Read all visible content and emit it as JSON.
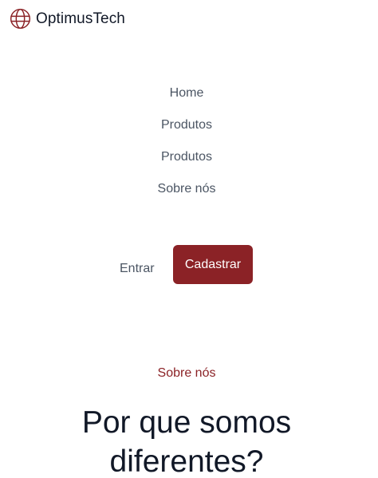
{
  "brand": {
    "name": "OptimusTech",
    "icon": "globe-icon",
    "color": "#8b2226"
  },
  "nav": {
    "items": [
      {
        "label": "Home"
      },
      {
        "label": "Produtos"
      },
      {
        "label": "Produtos"
      },
      {
        "label": "Sobre nós"
      }
    ]
  },
  "auth": {
    "login_label": "Entrar",
    "signup_label": "Cadastrar"
  },
  "section": {
    "eyebrow": "Sobre nós",
    "title_line1": "Por que somos",
    "title_line2": "diferentes?"
  },
  "colors": {
    "accent": "#8b2226",
    "nav_text": "#4b5563",
    "heading": "#111827",
    "background": "#ffffff"
  }
}
